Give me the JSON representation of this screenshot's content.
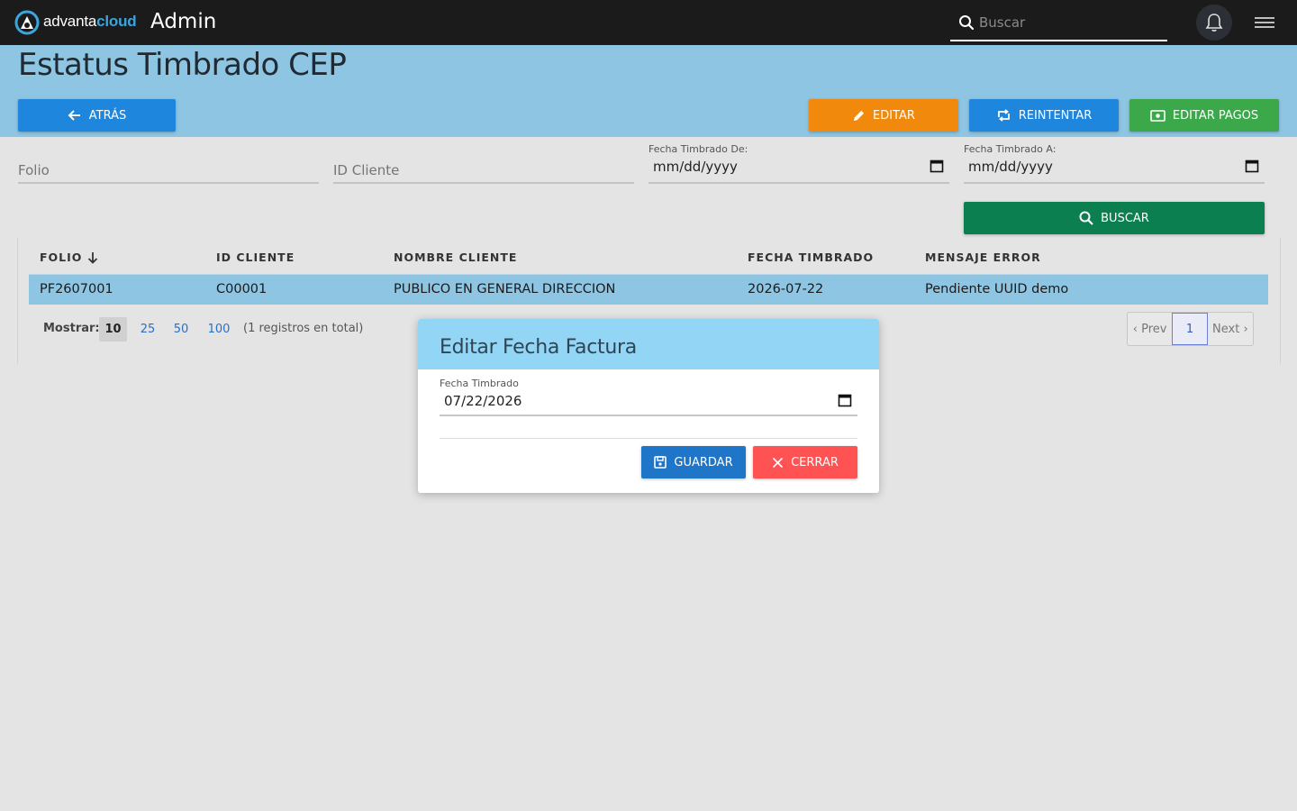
{
  "topbar": {
    "brand_prefix": "advanta",
    "brand_suffix": "cloud",
    "section": "Admin",
    "search_placeholder": "Buscar"
  },
  "page": {
    "title": "Estatus Timbrado CEP"
  },
  "actions": {
    "back": "ATRÁS",
    "edit": "EDITAR",
    "retry": "REINTENTAR",
    "edit_payments": "EDITAR PAGOS",
    "search": "BUSCAR"
  },
  "filters": {
    "folio_placeholder": "Folio",
    "client_id_placeholder": "ID Cliente",
    "date_from_label": "Fecha Timbrado De:",
    "date_from_value": "mm/dd/yyyy",
    "date_to_label": "Fecha Timbrado A:",
    "date_to_value": "mm/dd/yyyy"
  },
  "table": {
    "columns": [
      "FOLIO",
      "ID CLIENTE",
      "NOMBRE CLIENTE",
      "FECHA TIMBRADO",
      "MENSAJE ERROR"
    ],
    "rows": [
      [
        "PF2607001",
        "C00001",
        "PUBLICO EN GENERAL DIRECCION",
        "2026-07-22",
        "Pendiente UUID demo"
      ]
    ]
  },
  "pagination": {
    "show_label": "Mostrar:",
    "page_sizes": [
      "10",
      "25",
      "50",
      "100"
    ],
    "selected_size": "10",
    "total_text": "(1 registros en total)",
    "prev": "‹ Prev",
    "current_page": "1",
    "next": "Next ›"
  },
  "modal": {
    "title": "Editar Fecha Factura",
    "field_label": "Fecha Timbrado",
    "field_value": "07/22/2026",
    "save": "GUARDAR",
    "close": "CERRAR"
  },
  "colors": {
    "topbar": "#1b1b1b",
    "band": "#8ec5e3",
    "primary": "#1f86dd",
    "warning": "#f0890c",
    "success": "#3ba84a",
    "search": "#0b7f4f",
    "danger": "#ff5252"
  }
}
